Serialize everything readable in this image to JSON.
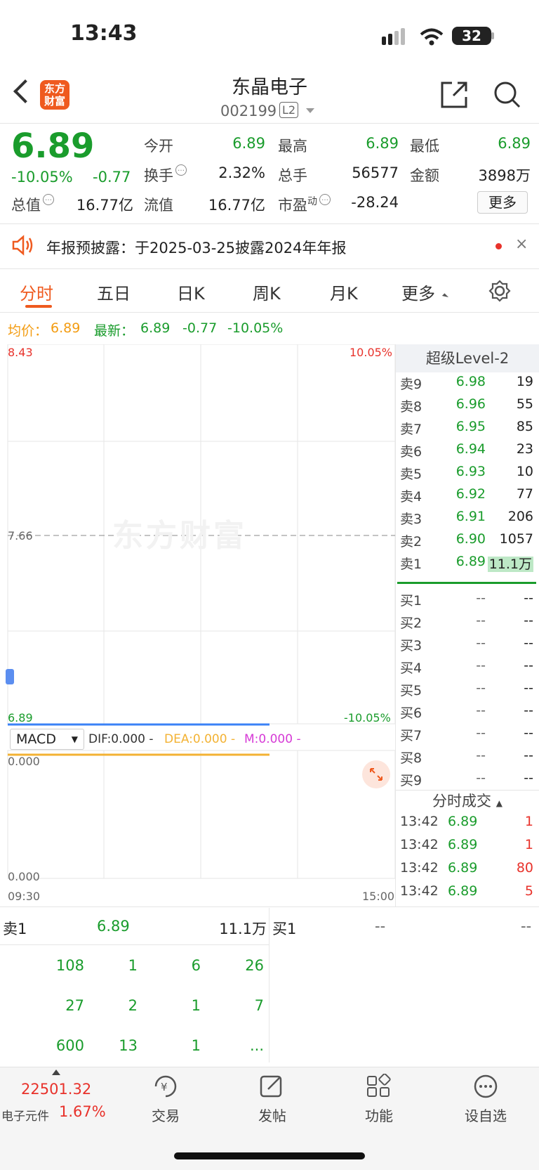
{
  "status": {
    "time": "13:43",
    "battery": "32"
  },
  "header": {
    "name": "东晶电子",
    "code": "002199",
    "badge": "L2",
    "logo_text": "东方财富"
  },
  "quote": {
    "price": "6.89",
    "pct": "-10.05%",
    "change": "-0.77",
    "open_label": "今开",
    "open": "6.89",
    "high_label": "最高",
    "high": "6.89",
    "low_label": "最低",
    "low": "6.89",
    "turnover_label": "换手",
    "turnover": "2.32%",
    "vol_label": "总手",
    "vol": "56577",
    "amount_label": "金额",
    "amount": "3898万",
    "mktcap_label": "总值",
    "mktcap": "16.77亿",
    "float_label": "流值",
    "float": "16.77亿",
    "pe_label": "市盈",
    "pe_sup": "动",
    "pe": "-28.24",
    "more": "更多"
  },
  "notice": {
    "text": "年报预披露：于2025-03-25披露2024年年报",
    "close": "×"
  },
  "tabs": [
    "分时",
    "五日",
    "日K",
    "周K",
    "月K",
    "更多"
  ],
  "summary": {
    "avg_label": "均价：",
    "avg": "6.89",
    "last_label": "最新：",
    "last": "6.89",
    "chg": "-0.77",
    "pct": "-10.05%"
  },
  "chart": {
    "y_top": "8.43",
    "y_mid": "7.66",
    "y_bottom": "6.89",
    "pct_top": "10.05%",
    "pct_bottom": "-10.05%",
    "watermark": "东方财富",
    "macd_label": "MACD",
    "dif": "DIF:0.000 -",
    "dea": "DEA:0.000 -",
    "m": "M:0.000 -",
    "macd_top": "0.000",
    "macd_bottom": "0.000",
    "time_start": "09:30",
    "time_end": "15:00"
  },
  "orderbook": {
    "title": "超级Level-2",
    "asks": [
      {
        "label": "卖9",
        "price": "6.98",
        "vol": "19"
      },
      {
        "label": "卖8",
        "price": "6.96",
        "vol": "55"
      },
      {
        "label": "卖7",
        "price": "6.95",
        "vol": "85"
      },
      {
        "label": "卖6",
        "price": "6.94",
        "vol": "23"
      },
      {
        "label": "卖5",
        "price": "6.93",
        "vol": "10"
      },
      {
        "label": "卖4",
        "price": "6.92",
        "vol": "77"
      },
      {
        "label": "卖3",
        "price": "6.91",
        "vol": "206"
      },
      {
        "label": "卖2",
        "price": "6.90",
        "vol": "1057"
      },
      {
        "label": "卖1",
        "price": "6.89",
        "vol": "11.1万"
      }
    ],
    "bids": [
      {
        "label": "买1",
        "price": "--",
        "vol": "--"
      },
      {
        "label": "买2",
        "price": "--",
        "vol": "--"
      },
      {
        "label": "买3",
        "price": "--",
        "vol": "--"
      },
      {
        "label": "买4",
        "price": "--",
        "vol": "--"
      },
      {
        "label": "买5",
        "price": "--",
        "vol": "--"
      },
      {
        "label": "买6",
        "price": "--",
        "vol": "--"
      },
      {
        "label": "买7",
        "price": "--",
        "vol": "--"
      },
      {
        "label": "买8",
        "price": "--",
        "vol": "--"
      },
      {
        "label": "买9",
        "price": "--",
        "vol": "--"
      }
    ],
    "ticks_title": "分时成交",
    "ticks": [
      {
        "time": "13:42",
        "price": "6.89",
        "vol": "1"
      },
      {
        "time": "13:42",
        "price": "6.89",
        "vol": "1"
      },
      {
        "time": "13:42",
        "price": "6.89",
        "vol": "80"
      },
      {
        "time": "13:42",
        "price": "6.89",
        "vol": "5"
      }
    ]
  },
  "bottom_panel": {
    "ask_label": "卖1",
    "ask_price": "6.89",
    "ask_vol": "11.1万",
    "bid_label": "买1",
    "bid_price": "--",
    "bid_vol": "--",
    "rows": [
      [
        "108",
        "1",
        "6",
        "26"
      ],
      [
        "27",
        "2",
        "1",
        "7"
      ],
      [
        "600",
        "13",
        "1",
        "..."
      ]
    ]
  },
  "nav": {
    "index_value": "22501.32",
    "index_name": "电子元件",
    "index_pct": "1.67%",
    "items": [
      "交易",
      "发帖",
      "功能",
      "设自选"
    ]
  }
}
